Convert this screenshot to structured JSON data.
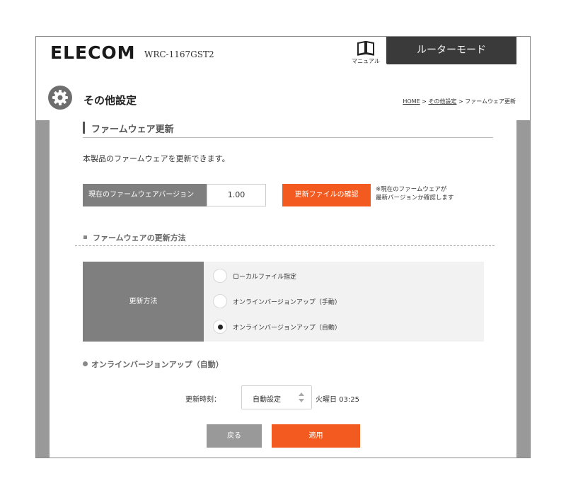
{
  "header": {
    "logo": "ELECOM",
    "model": "WRC-1167GST2",
    "manual_label": "マニュアル",
    "mode_label": "ルーターモード"
  },
  "page": {
    "title": "その他設定",
    "breadcrumb": {
      "home": "HOME",
      "sep1": " > ",
      "parent": "その他設定",
      "sep2": " > ",
      "current": "ファームウェア更新"
    }
  },
  "firmware": {
    "section_title": "ファームウェア更新",
    "description": "本製品のファームウェアを更新できます。",
    "current_version_label": "現在のファームウェアバージョン",
    "current_version_value": "1.00",
    "check_button": "更新ファイルの確認",
    "note_line1": "※現在のファームウェアが",
    "note_line2": "最新バージョンか確認します"
  },
  "method": {
    "section_title": "ファームウェアの更新方法",
    "label": "更新方法",
    "options": [
      {
        "label": "ローカルファイル指定",
        "selected": false
      },
      {
        "label": "オンラインバージョンアップ（手動）",
        "selected": false
      },
      {
        "label": "オンラインバージョンアップ（自動）",
        "selected": true
      }
    ]
  },
  "online": {
    "section_title": "オンラインバージョンアップ（自動）",
    "time_label": "更新時刻：",
    "select_value": "自動設定",
    "time_text": "火曜日 03:25"
  },
  "actions": {
    "back_label": "戻る",
    "apply_label": "適用"
  },
  "colors": {
    "accent": "#f25a1f",
    "label_bg": "#7f7f7f",
    "header_dark": "#3a3a3a"
  }
}
